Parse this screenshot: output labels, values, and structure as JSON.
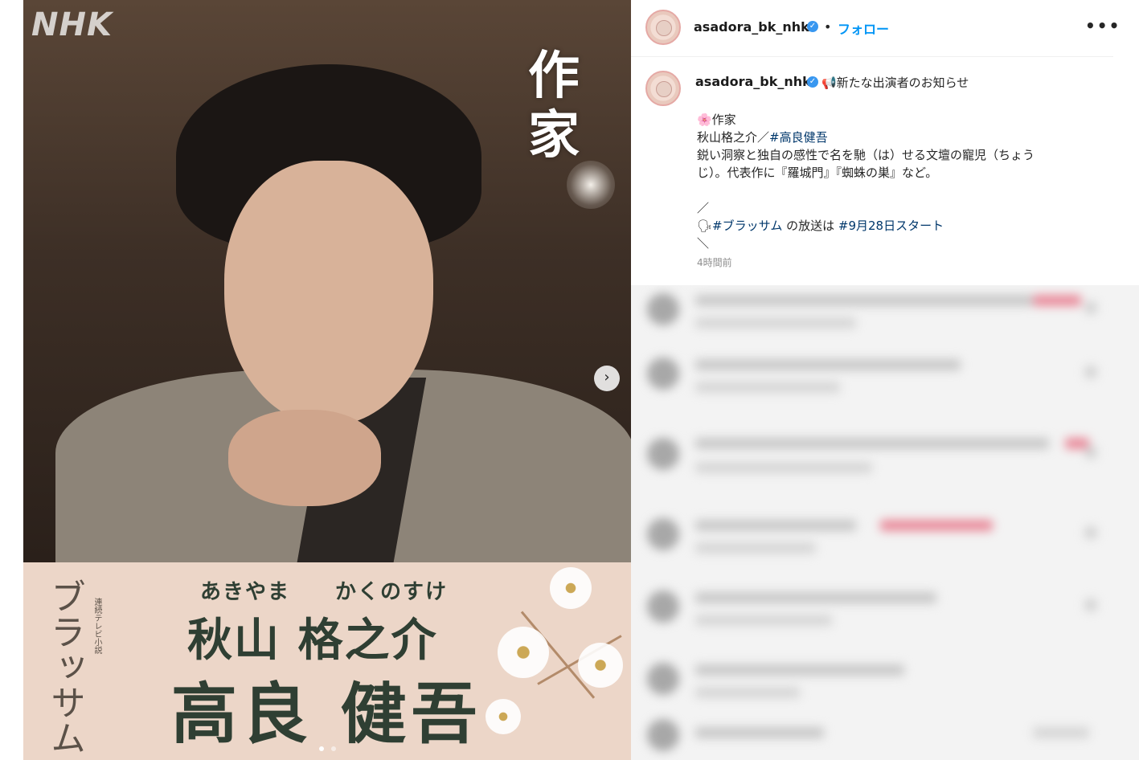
{
  "media": {
    "logo_text": "NHK",
    "role_label": "作家",
    "next_icon": "›",
    "banner": {
      "drama_title": "ブラッサム",
      "drama_tag": "連続テレビ小説",
      "kana": "あきやま　　かくのすけ",
      "role_name": "秋山 格之介",
      "actor_name": "高良 健吾"
    },
    "carousel": {
      "total": 2,
      "current": 1
    }
  },
  "header": {
    "username": "asadora_bk_nhk",
    "separator": "•",
    "follow_label": "フォロー",
    "more_label": "•••",
    "verified_icon": "✓"
  },
  "post": {
    "username": "asadora_bk_nhk",
    "headline": "📢新たな出演者のお知らせ",
    "lines": [
      "🌸作家",
      "秋山格之介／",
      "",
      "鋭い洞察と独自の感性で名を馳（は）せる文壇の寵児（ちょう",
      "じ）。代表作に『羅城門』『蜘蛛の巣』など。",
      "",
      "／",
      "🗣",
      "",
      "の放送は",
      "",
      "＼"
    ],
    "hashtags": {
      "actor": "#高良健吾",
      "show": "#ブラッサム",
      "date": "#9月28日スタート"
    },
    "time": "4時間前"
  },
  "colors": {
    "link": "#00376b",
    "follow": "#0095f6",
    "verified": "#3897f0",
    "banner_bg": "#ecd6c8",
    "banner_text": "#2f3f33"
  }
}
